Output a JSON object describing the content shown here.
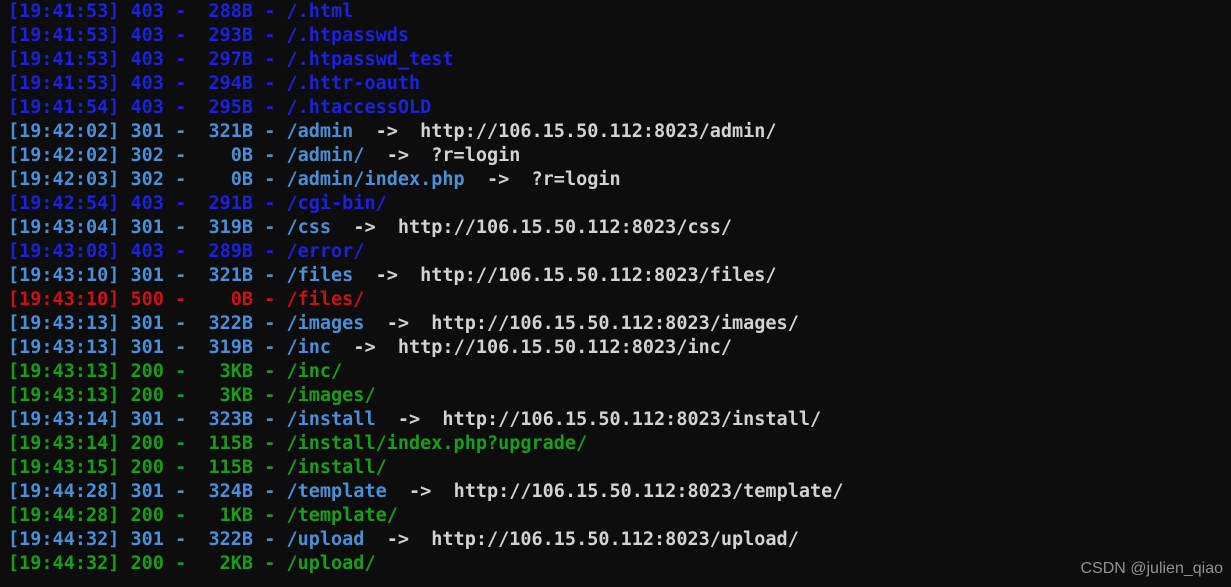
{
  "terminal": {
    "background_color": "#0d0d0d",
    "status_colors": {
      "403": "#1a22e0",
      "301": "#4a90d9",
      "302": "#4a90d9",
      "500": "#cc1212",
      "200": "#17a017",
      "target": "#d2d2d2"
    },
    "separator": "-",
    "arrow": "->",
    "lines": [
      {
        "time": "[19:41:53]",
        "status": "403",
        "size": "288B",
        "path": "/.html",
        "arrow": "",
        "target": ""
      },
      {
        "time": "[19:41:53]",
        "status": "403",
        "size": "293B",
        "path": "/.htpasswds",
        "arrow": "",
        "target": ""
      },
      {
        "time": "[19:41:53]",
        "status": "403",
        "size": "297B",
        "path": "/.htpasswd_test",
        "arrow": "",
        "target": ""
      },
      {
        "time": "[19:41:53]",
        "status": "403",
        "size": "294B",
        "path": "/.httr-oauth",
        "arrow": "",
        "target": ""
      },
      {
        "time": "[19:41:54]",
        "status": "403",
        "size": "295B",
        "path": "/.htaccessOLD",
        "arrow": "",
        "target": ""
      },
      {
        "time": "[19:42:02]",
        "status": "301",
        "size": "321B",
        "path": "/admin",
        "arrow": "->",
        "target": "http://106.15.50.112:8023/admin/"
      },
      {
        "time": "[19:42:02]",
        "status": "302",
        "size": "0B",
        "path": "/admin/",
        "arrow": "->",
        "target": "?r=login"
      },
      {
        "time": "[19:42:03]",
        "status": "302",
        "size": "0B",
        "path": "/admin/index.php",
        "arrow": "->",
        "target": "?r=login"
      },
      {
        "time": "[19:42:54]",
        "status": "403",
        "size": "291B",
        "path": "/cgi-bin/",
        "arrow": "",
        "target": ""
      },
      {
        "time": "[19:43:04]",
        "status": "301",
        "size": "319B",
        "path": "/css",
        "arrow": "->",
        "target": "http://106.15.50.112:8023/css/"
      },
      {
        "time": "[19:43:08]",
        "status": "403",
        "size": "289B",
        "path": "/error/",
        "arrow": "",
        "target": ""
      },
      {
        "time": "[19:43:10]",
        "status": "301",
        "size": "321B",
        "path": "/files",
        "arrow": "->",
        "target": "http://106.15.50.112:8023/files/"
      },
      {
        "time": "[19:43:10]",
        "status": "500",
        "size": "0B",
        "path": "/files/",
        "arrow": "",
        "target": ""
      },
      {
        "time": "[19:43:13]",
        "status": "301",
        "size": "322B",
        "path": "/images",
        "arrow": "->",
        "target": "http://106.15.50.112:8023/images/"
      },
      {
        "time": "[19:43:13]",
        "status": "301",
        "size": "319B",
        "path": "/inc",
        "arrow": "->",
        "target": "http://106.15.50.112:8023/inc/"
      },
      {
        "time": "[19:43:13]",
        "status": "200",
        "size": "3KB",
        "path": "/inc/",
        "arrow": "",
        "target": ""
      },
      {
        "time": "[19:43:13]",
        "status": "200",
        "size": "3KB",
        "path": "/images/",
        "arrow": "",
        "target": ""
      },
      {
        "time": "[19:43:14]",
        "status": "301",
        "size": "323B",
        "path": "/install",
        "arrow": "->",
        "target": "http://106.15.50.112:8023/install/"
      },
      {
        "time": "[19:43:14]",
        "status": "200",
        "size": "115B",
        "path": "/install/index.php?upgrade/",
        "arrow": "",
        "target": ""
      },
      {
        "time": "[19:43:15]",
        "status": "200",
        "size": "115B",
        "path": "/install/",
        "arrow": "",
        "target": ""
      },
      {
        "time": "[19:44:28]",
        "status": "301",
        "size": "324B",
        "path": "/template",
        "arrow": "->",
        "target": "http://106.15.50.112:8023/template/"
      },
      {
        "time": "[19:44:28]",
        "status": "200",
        "size": "1KB",
        "path": "/template/",
        "arrow": "",
        "target": ""
      },
      {
        "time": "[19:44:32]",
        "status": "301",
        "size": "322B",
        "path": "/upload",
        "arrow": "->",
        "target": "http://106.15.50.112:8023/upload/"
      },
      {
        "time": "[19:44:32]",
        "status": "200",
        "size": "2KB",
        "path": "/upload/",
        "arrow": "",
        "target": ""
      }
    ]
  },
  "watermark": {
    "text": "CSDN @julien_qiao"
  }
}
